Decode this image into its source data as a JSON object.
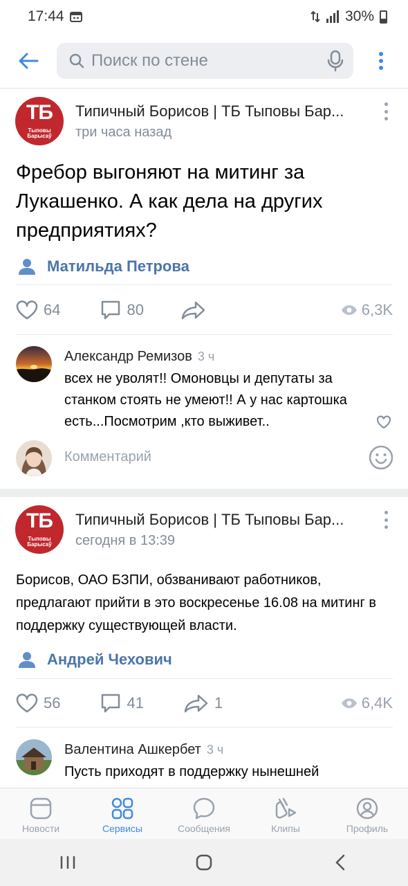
{
  "status": {
    "time": "17:44",
    "battery": "30%"
  },
  "search": {
    "placeholder": "Поиск по стене"
  },
  "posts": [
    {
      "author": "Типичный Борисов | ТБ Тыповы Бар...",
      "time": "три часа назад",
      "avatar_text": "ТБ",
      "avatar_sub": "Тыповы Барысаў",
      "text": "Фребор выгоняют на митинг за Лукашенко. А как дела на других предприятиях?",
      "signer": "Матильда Петрова",
      "likes": "64",
      "comments": "80",
      "shares": "",
      "views": "6,3K",
      "comment": {
        "author": "Александр Ремизов",
        "when": "3 ч",
        "text": "всех не уволят!! Омоновцы и депутаты за станком стоять не умеют!! А у нас картошка есть...Посмотрим ,кто выживет.."
      },
      "compose_placeholder": "Комментарий"
    },
    {
      "author": "Типичный Борисов | ТБ Тыповы Бар...",
      "time": "сегодня в 13:39",
      "avatar_text": "ТБ",
      "avatar_sub": "Тыповы Барысаў",
      "text": "Борисов, ОАО БЗПИ, обзванивают работников, предлагают прийти в это воскресенье 16.08 на митинг в поддержку существующей власти.",
      "signer": "Андрей Чехович",
      "likes": "56",
      "comments": "41",
      "shares": "1",
      "views": "6,4K",
      "comment": {
        "author": "Валентина Ашкербет",
        "when": "3 ч",
        "text": "Пусть приходят в поддержку нынешней"
      }
    }
  ],
  "tabs": [
    {
      "label": "Новости",
      "icon": "news-icon"
    },
    {
      "label": "Сервисы",
      "icon": "services-icon",
      "active": true
    },
    {
      "label": "Сообщения",
      "icon": "messages-icon"
    },
    {
      "label": "Клипы",
      "icon": "clips-icon"
    },
    {
      "label": "Профиль",
      "icon": "profile-icon"
    }
  ],
  "colors": {
    "accent": "#3f8ae0",
    "link": "#4a76a8",
    "avatar_bg": "#c0282d",
    "secondary": "#818c99"
  }
}
